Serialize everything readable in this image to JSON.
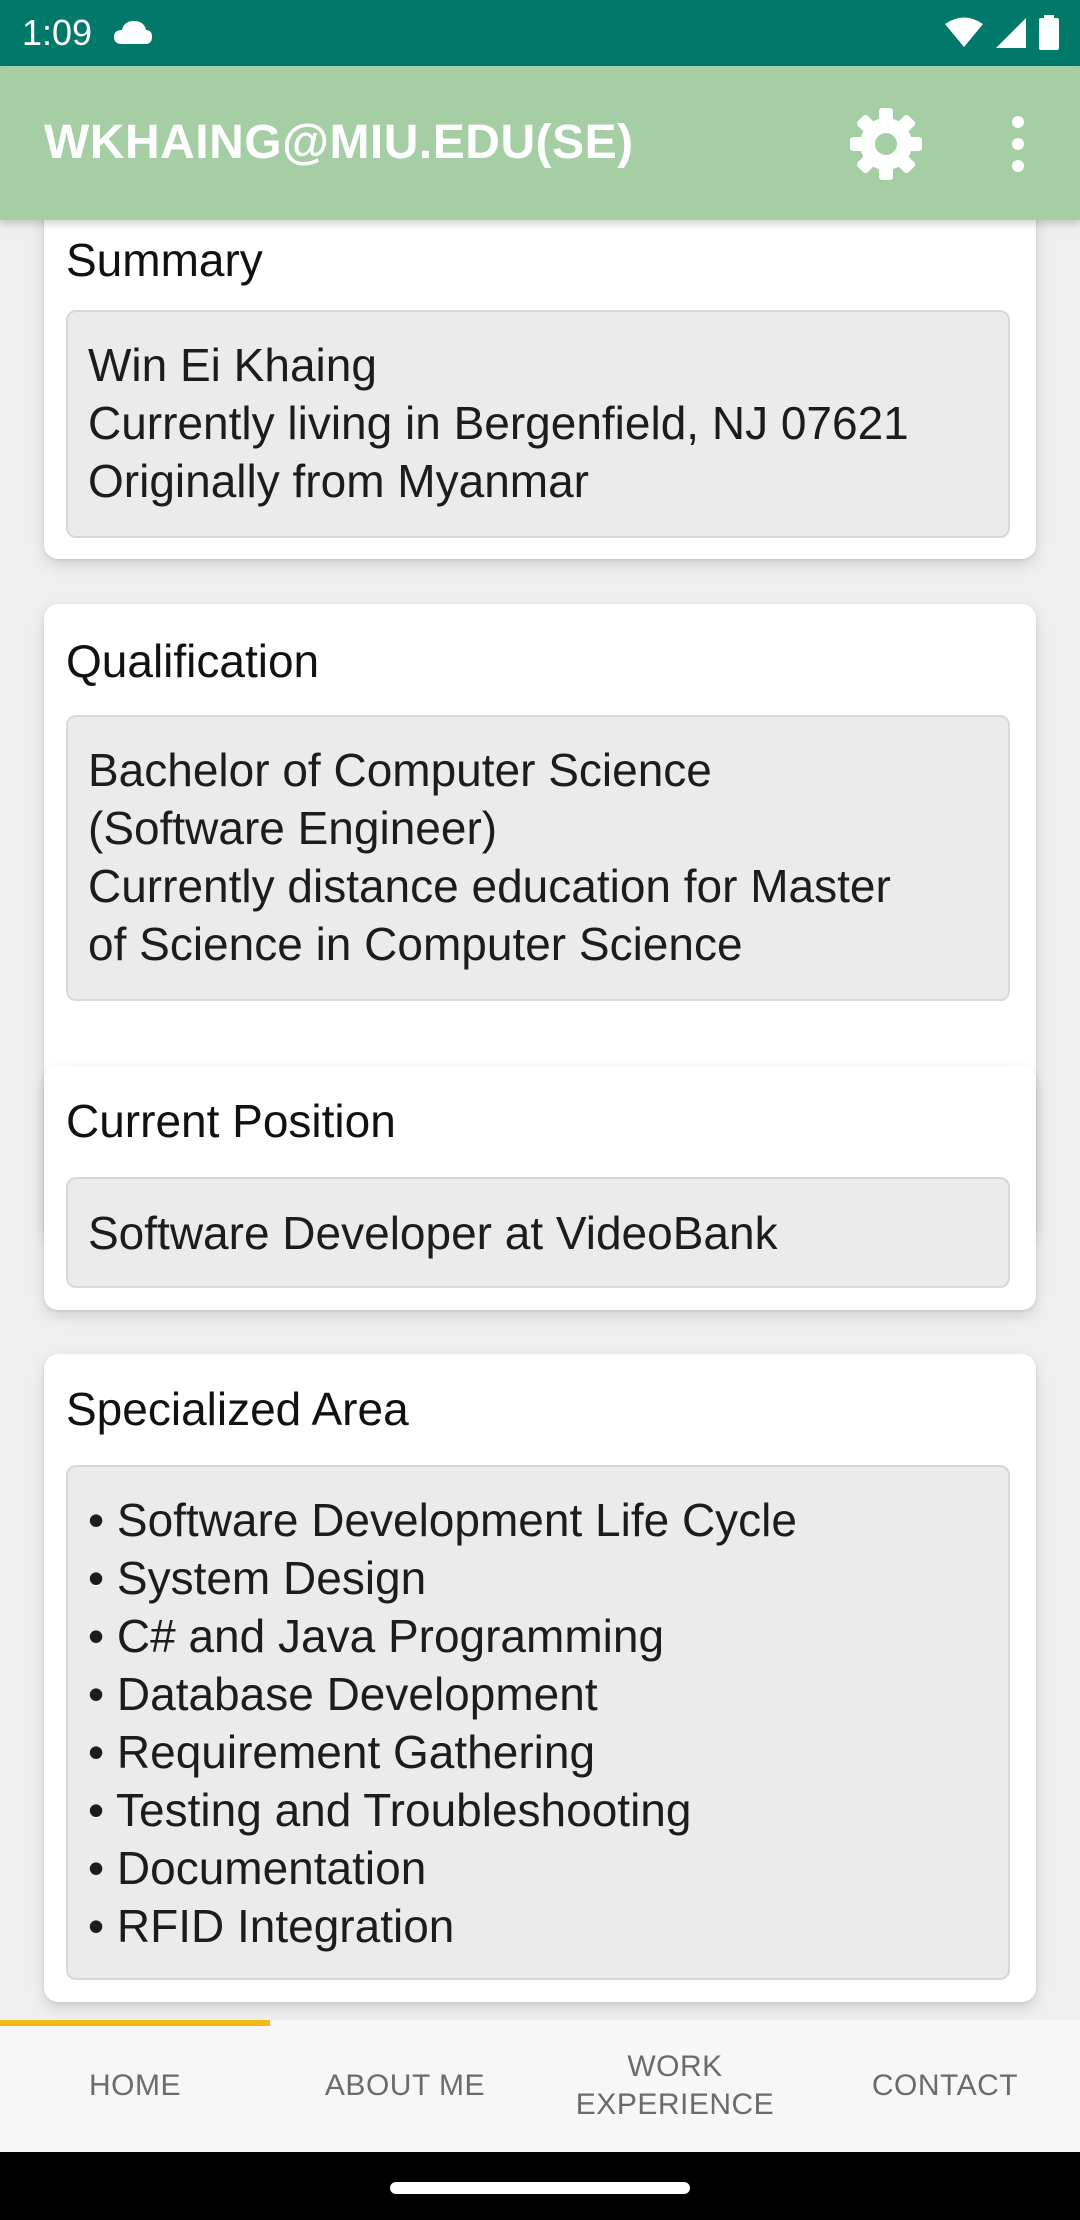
{
  "status_bar": {
    "time": "1:09"
  },
  "app_bar": {
    "title": "WKHAING@MIU.EDU(SE)",
    "settings_icon": "gear-icon",
    "overflow_icon": "more-vert-icon"
  },
  "cards": {
    "summary": {
      "title": "Summary",
      "lines": [
        "Win Ei Khaing",
        "Currently living in Bergenfield, NJ 07621",
        "Originally from Myanmar"
      ]
    },
    "qualification": {
      "title": "Qualification",
      "lines": [
        "Bachelor of Computer Science",
        "(Software Engineer)",
        "Currently distance education for Master",
        "of Science in Computer Science"
      ]
    },
    "position": {
      "title": "Current Position",
      "lines": [
        "Software Developer at VideoBank"
      ]
    },
    "specialized": {
      "title": "Specialized Area",
      "lines": [
        "• Software Development Life Cycle",
        "• System Design",
        "• C# and Java Programming",
        "• Database Development",
        "• Requirement Gathering",
        "• Testing and Troubleshooting",
        "• Documentation",
        "• RFID Integration"
      ]
    }
  },
  "tabs": [
    {
      "label_line1": "HOME",
      "label_line2": ""
    },
    {
      "label_line1": "ABOUT ME",
      "label_line2": ""
    },
    {
      "label_line1": "WORK",
      "label_line2": "EXPERIENCE"
    },
    {
      "label_line1": "CONTACT",
      "label_line2": ""
    }
  ],
  "selected_tab": "HOME",
  "colors": {
    "status_bar": "#00796b",
    "app_bar": "#a5cea5",
    "tab_indicator": "#f5b915"
  }
}
